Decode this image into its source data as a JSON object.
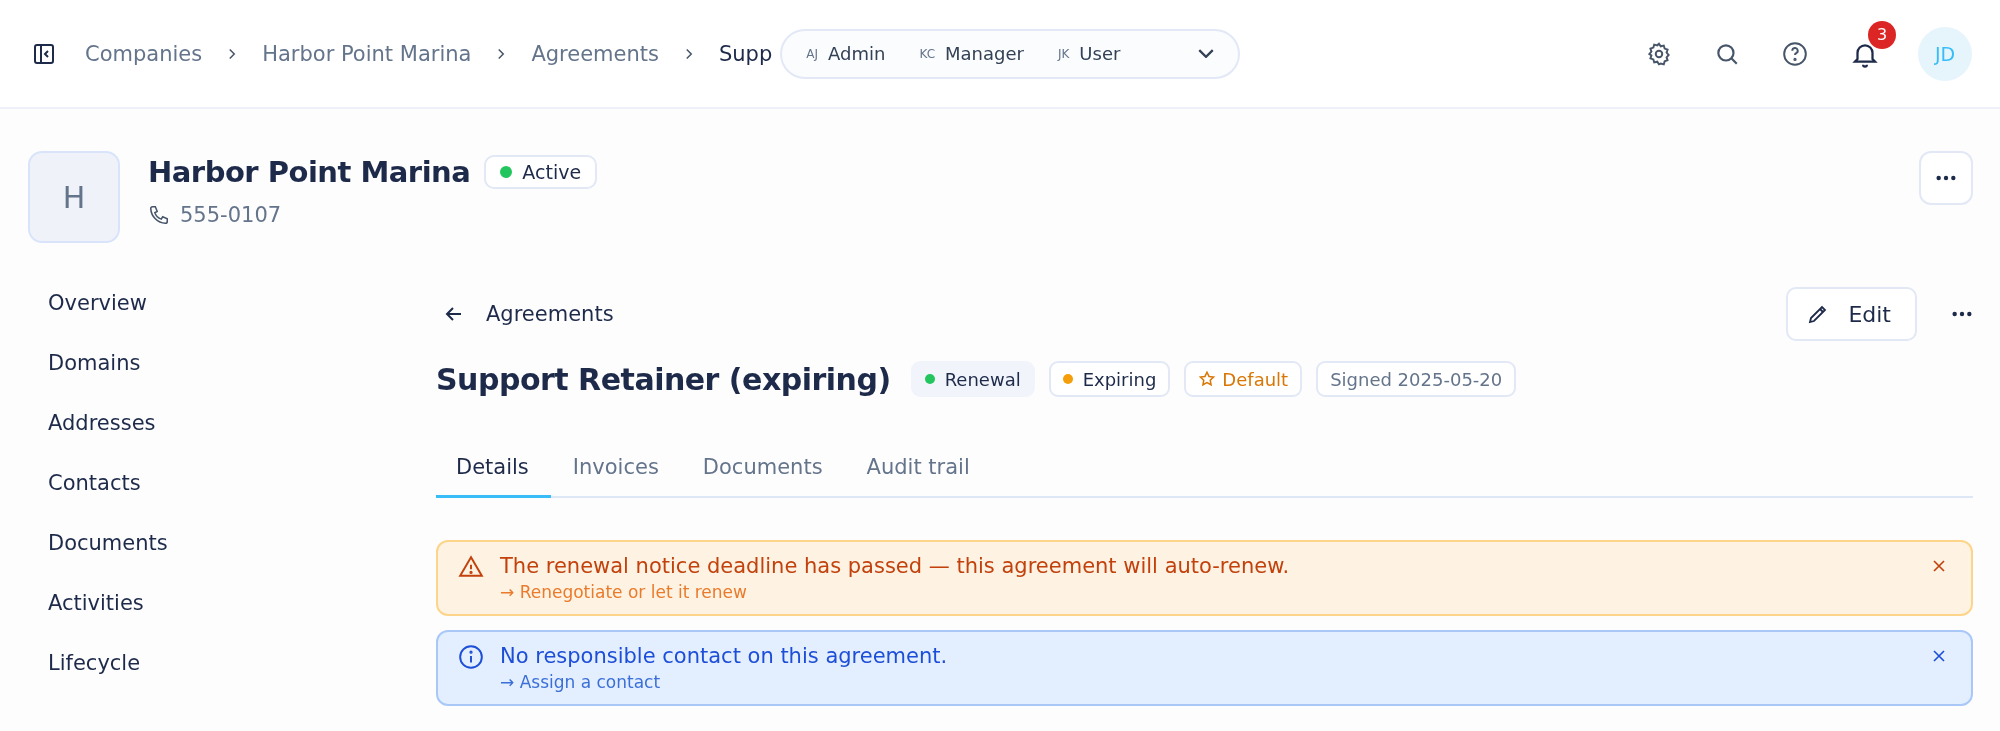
{
  "breadcrumbs": [
    {
      "label": "Companies",
      "current": false
    },
    {
      "label": "Harbor Point Marina",
      "current": false
    },
    {
      "label": "Agreements",
      "current": false
    },
    {
      "label": "Supp",
      "current": true
    }
  ],
  "role_switcher": {
    "options": [
      {
        "initials": "AJ",
        "role": "Admin"
      },
      {
        "initials": "KC",
        "role": "Manager"
      },
      {
        "initials": "JK",
        "role": "User"
      }
    ]
  },
  "notifications": {
    "count": "3"
  },
  "user": {
    "initials": "JD"
  },
  "company": {
    "initial": "H",
    "name": "Harbor Point Marina",
    "status": {
      "label": "Active",
      "color": "#22c55e"
    },
    "phone": "555-0107"
  },
  "sidebar": {
    "items": [
      {
        "label": "Overview",
        "selected": false
      },
      {
        "label": "Domains",
        "selected": false
      },
      {
        "label": "Addresses",
        "selected": false
      },
      {
        "label": "Contacts",
        "selected": false
      },
      {
        "label": "Documents",
        "selected": false
      },
      {
        "label": "Activities",
        "selected": false
      },
      {
        "label": "Lifecycle",
        "selected": false
      }
    ]
  },
  "agreement": {
    "back_label": "Agreements",
    "edit_label": "Edit",
    "title": "Support Retainer (expiring)",
    "badges": [
      {
        "kind": "dot",
        "label": "Renewal",
        "color": "#22c55e"
      },
      {
        "kind": "dot",
        "label": "Expiring",
        "color": "#f59e0b"
      },
      {
        "kind": "star",
        "label": "Default"
      },
      {
        "kind": "plain",
        "label": "Signed 2025-05-20"
      }
    ]
  },
  "tabs": [
    {
      "label": "Details",
      "selected": true
    },
    {
      "label": "Invoices",
      "selected": false
    },
    {
      "label": "Documents",
      "selected": false
    },
    {
      "label": "Audit trail",
      "selected": false
    }
  ],
  "alerts": [
    {
      "kind": "warning",
      "message": "The renewal notice deadline has passed — this agreement will auto-renew.",
      "action": "→ Renegotiate or let it renew"
    },
    {
      "kind": "info",
      "message": "No responsible contact on this agreement.",
      "action": "→ Assign a contact"
    }
  ]
}
